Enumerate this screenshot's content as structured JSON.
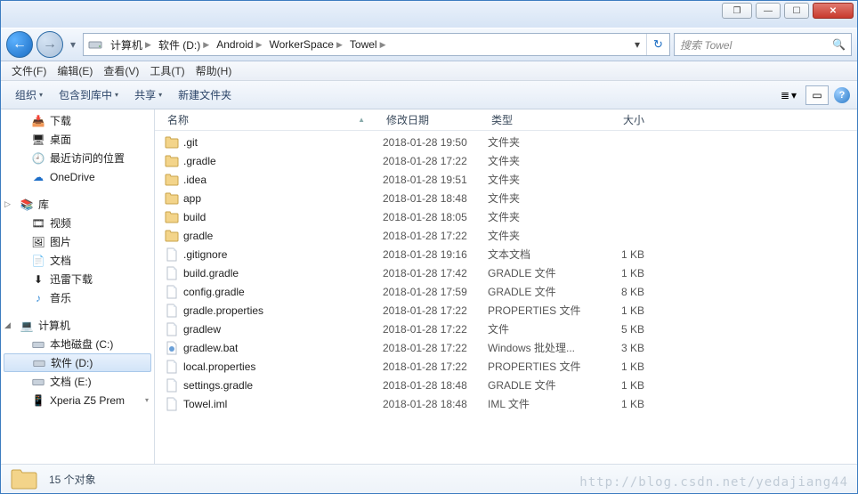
{
  "titlebar": {
    "popout": "❐",
    "min": "—",
    "max": "☐",
    "close": "✕"
  },
  "nav": {
    "back": "←",
    "fwd": "→",
    "drop": "▾",
    "crumbs": [
      "计算机",
      "软件 (D:)",
      "Android",
      "WorkerSpace",
      "Towel"
    ],
    "addr_drop": "▾",
    "refresh": "↻",
    "search_placeholder": "搜索 Towel"
  },
  "menu": [
    "文件(F)",
    "编辑(E)",
    "查看(V)",
    "工具(T)",
    "帮助(H)"
  ],
  "toolbar": {
    "organize": "组织",
    "include": "包含到库中",
    "share": "共享",
    "newfolder": "新建文件夹",
    "dd": "▾",
    "view": "≣",
    "pane": "▭",
    "help": "?"
  },
  "sidebar": {
    "favorites": {
      "downloads": "下载",
      "desktop": "桌面",
      "recent": "最近访问的位置",
      "onedrive": "OneDrive"
    },
    "libraries": {
      "label": "库",
      "video": "视频",
      "pictures": "图片",
      "documents": "文档",
      "xunlei": "迅雷下载",
      "music": "音乐"
    },
    "computer": {
      "label": "计算机",
      "c": "本地磁盘 (C:)",
      "d": "软件 (D:)",
      "e": "文档 (E:)",
      "xperia": "Xperia Z5 Prem"
    },
    "tri_closed": "▷",
    "tri_open": "◢",
    "dd": "▾"
  },
  "columns": {
    "name": "名称",
    "date": "修改日期",
    "type": "类型",
    "size": "大小",
    "sort": "▲"
  },
  "files": [
    {
      "ico": "folder",
      "name": ".git",
      "date": "2018-01-28 19:50",
      "type": "文件夹",
      "size": ""
    },
    {
      "ico": "folder",
      "name": ".gradle",
      "date": "2018-01-28 17:22",
      "type": "文件夹",
      "size": ""
    },
    {
      "ico": "folder",
      "name": ".idea",
      "date": "2018-01-28 19:51",
      "type": "文件夹",
      "size": ""
    },
    {
      "ico": "folder",
      "name": "app",
      "date": "2018-01-28 18:48",
      "type": "文件夹",
      "size": ""
    },
    {
      "ico": "folder",
      "name": "build",
      "date": "2018-01-28 18:05",
      "type": "文件夹",
      "size": ""
    },
    {
      "ico": "folder",
      "name": "gradle",
      "date": "2018-01-28 17:22",
      "type": "文件夹",
      "size": ""
    },
    {
      "ico": "file",
      "name": ".gitignore",
      "date": "2018-01-28 19:16",
      "type": "文本文档",
      "size": "1 KB"
    },
    {
      "ico": "file",
      "name": "build.gradle",
      "date": "2018-01-28 17:42",
      "type": "GRADLE 文件",
      "size": "1 KB"
    },
    {
      "ico": "file",
      "name": "config.gradle",
      "date": "2018-01-28 17:59",
      "type": "GRADLE 文件",
      "size": "8 KB"
    },
    {
      "ico": "file",
      "name": "gradle.properties",
      "date": "2018-01-28 17:22",
      "type": "PROPERTIES 文件",
      "size": "1 KB"
    },
    {
      "ico": "file",
      "name": "gradlew",
      "date": "2018-01-28 17:22",
      "type": "文件",
      "size": "5 KB"
    },
    {
      "ico": "bat",
      "name": "gradlew.bat",
      "date": "2018-01-28 17:22",
      "type": "Windows 批处理...",
      "size": "3 KB"
    },
    {
      "ico": "file",
      "name": "local.properties",
      "date": "2018-01-28 17:22",
      "type": "PROPERTIES 文件",
      "size": "1 KB"
    },
    {
      "ico": "file",
      "name": "settings.gradle",
      "date": "2018-01-28 18:48",
      "type": "GRADLE 文件",
      "size": "1 KB"
    },
    {
      "ico": "file",
      "name": "Towel.iml",
      "date": "2018-01-28 18:48",
      "type": "IML 文件",
      "size": "1 KB"
    }
  ],
  "status": {
    "count": "15 个对象"
  },
  "watermark": "http://blog.csdn.net/yedajiang44"
}
